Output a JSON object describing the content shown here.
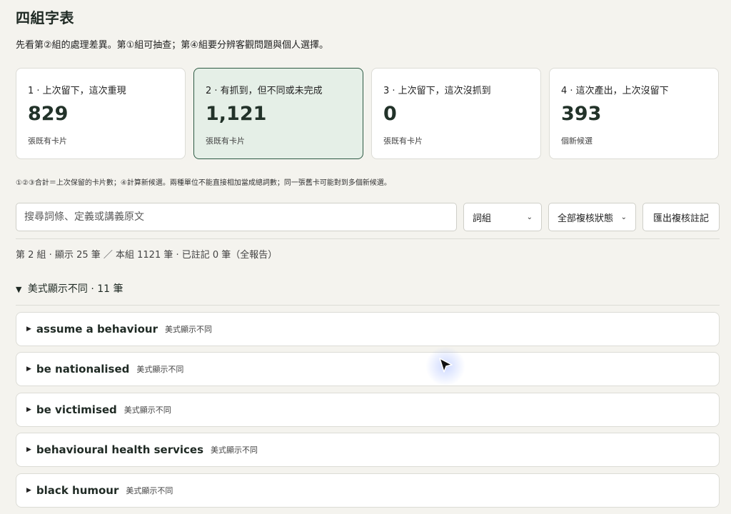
{
  "header": {
    "title": "四組字表",
    "subtitle": "先看第②組的處理差異。第①組可抽查；第④組要分辨客觀問題與個人選擇。"
  },
  "cards": [
    {
      "label": "1 · 上次留下，這次重現",
      "value": "829",
      "unit": "張既有卡片",
      "active": false
    },
    {
      "label": "2 · 有抓到，但不同或未完成",
      "value": "1,121",
      "unit": "張既有卡片",
      "active": true
    },
    {
      "label": "3 · 上次留下，這次沒抓到",
      "value": "0",
      "unit": "張既有卡片",
      "active": false
    },
    {
      "label": "4 · 這次產出，上次沒留下",
      "value": "393",
      "unit": "個新候選",
      "active": false
    }
  ],
  "note": "①②③合計＝上次保留的卡片數；④計算新候選。兩種單位不能直接相加當成總詞數；同一張舊卡可能對到多個新候選。",
  "toolbar": {
    "search_placeholder": "搜尋詞條、定義或講義原文",
    "type_select": "詞組",
    "status_select": "全部複核狀態",
    "export_label": "匯出複核註記"
  },
  "status_text": "第 2 組 · 顯示 25 筆 ／ 本組 1121 筆 · 已註記 0 筆（全報告）",
  "group": {
    "marker": "▼",
    "label": "美式顯示不同 · 11 筆"
  },
  "rows": [
    {
      "term": "assume a behaviour",
      "tag": "美式顯示不同"
    },
    {
      "term": "be nationalised",
      "tag": "美式顯示不同"
    },
    {
      "term": "be victimised",
      "tag": "美式顯示不同"
    },
    {
      "term": "behavioural health services",
      "tag": "美式顯示不同"
    },
    {
      "term": "black humour",
      "tag": "美式顯示不同"
    }
  ],
  "colors": {
    "background": "#f4f3ee",
    "accent": "#2d5a43",
    "active_card": "#e5efe7"
  }
}
